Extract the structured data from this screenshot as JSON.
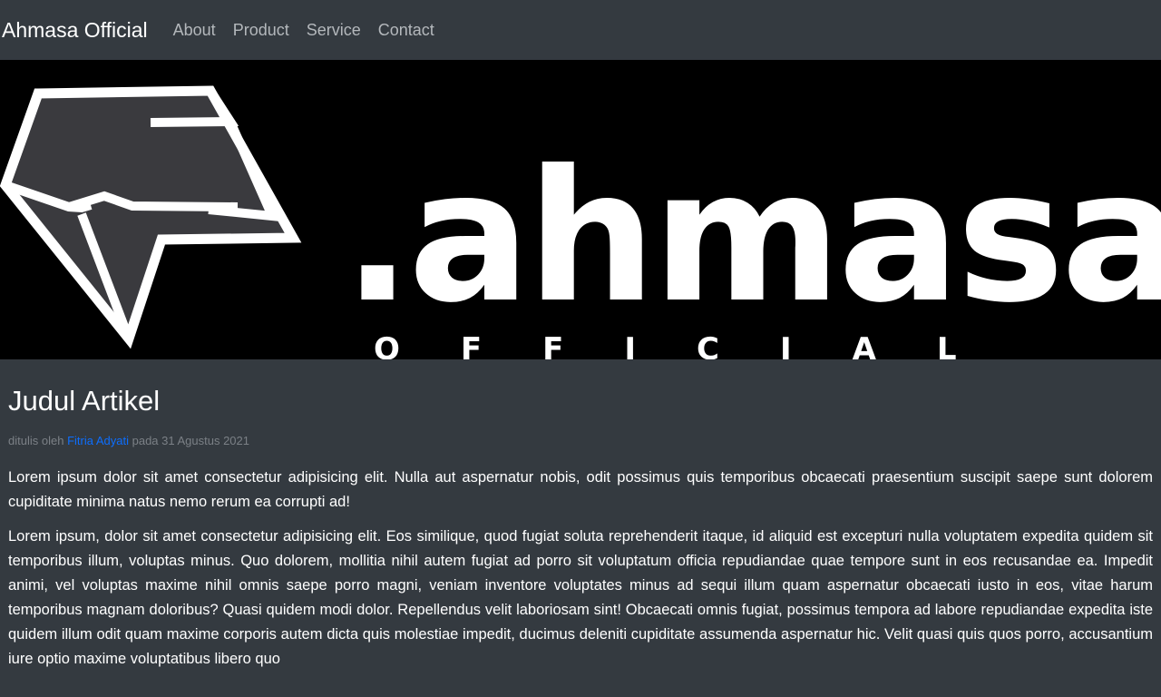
{
  "navbar": {
    "brand": "Ahmasa Official",
    "links": [
      "About",
      "Product",
      "Service",
      "Contact"
    ]
  },
  "hero": {
    "logo_text": ".ahmasa?",
    "logo_subtext": "OFFICIAL"
  },
  "article": {
    "title": "Judul Artikel",
    "meta_prefix": "ditulis oleh",
    "author": "Fitria Adyati",
    "meta_date": "pada 31 Agustus 2021",
    "paragraphs": [
      "Lorem ipsum dolor sit amet consectetur adipisicing elit. Nulla aut aspernatur nobis, odit possimus quis temporibus obcaecati praesentium suscipit saepe sunt dolorem cupiditate minima natus nemo rerum ea corrupti ad!",
      "Lorem ipsum, dolor sit amet consectetur adipisicing elit. Eos similique, quod fugiat soluta reprehenderit itaque, id aliquid est excepturi nulla voluptatem expedita quidem sit temporibus illum, voluptas minus. Quo dolorem, mollitia nihil autem fugiat ad porro sit voluptatum officia repudiandae quae tempore sunt in eos recusandae ea. Impedit animi, vel voluptas maxime nihil omnis saepe porro magni, veniam inventore voluptates minus ad sequi illum quam aspernatur obcaecati iusto in eos, vitae harum temporibus magnam doloribus? Quasi quidem modi dolor. Repellendus velit laboriosam sint! Obcaecati omnis fugiat, possimus tempora ad labore repudiandae expedita iste quidem illum odit quam maxime corporis autem dicta quis molestiae impedit, ducimus deleniti cupiditate assumenda aspernatur hic. Velit quasi quis quos porro, accusantium iure optio maxime voluptatibus libero quo"
    ]
  },
  "colors": {
    "navbar_bg": "#343a40",
    "hero_bg": "#000000",
    "link": "#0d6efd",
    "muted": "#7b8086"
  }
}
